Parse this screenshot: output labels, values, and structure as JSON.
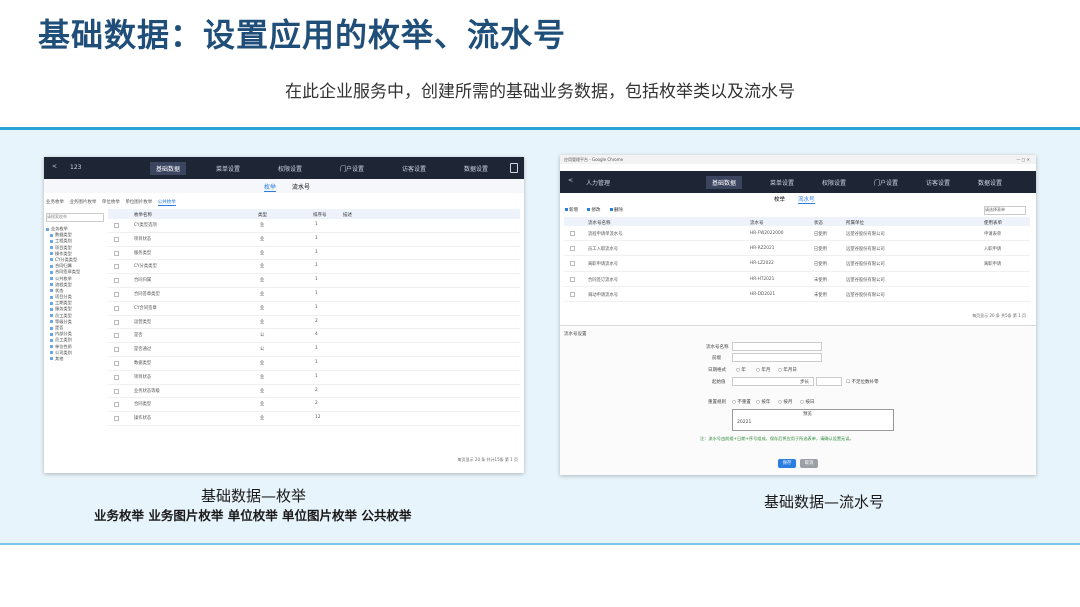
{
  "slide": {
    "title": "基础数据：设置应用的枚举、流水号",
    "subtitle": "在此企业服务中，创建所需的基础业务数据，包括枚举类以及流水号"
  },
  "left_caption": {
    "main": "基础数据—枚举",
    "sub": "业务枚举  业务图片枚举  单位枚举  单位图片枚举  公共枚举"
  },
  "right_caption": {
    "main": "基础数据—流水号"
  },
  "colors": {
    "title": "#1f4e79",
    "band": "#e8f4fb",
    "band_border": "#29a3d6",
    "nav": "#1e2535",
    "accent": "#2a7de1"
  },
  "shot1": {
    "app_name": "123",
    "menus": [
      "基础数据",
      "菜单设置",
      "权限设置",
      "门户设置",
      "访客设置",
      "数据设置"
    ],
    "tabs": [
      "枚举",
      "流水号"
    ],
    "subtabs": [
      "业务枚举",
      "业务图片枚举",
      "单位枚举",
      "单位图片枚举",
      "公共枚举"
    ],
    "search_placeholder": "请搜索枚举",
    "tree": [
      "业务枚举",
      "数据类型",
      "工程类别",
      "项目类型",
      "操作类型",
      "CY分类类型",
      "合同归属",
      "合同签章类型",
      "公共枚举",
      "流程类型",
      "状态",
      "项目分类",
      "工期类型",
      "服务类型",
      "员工类型",
      "等级分类",
      "是否",
      "内部分类",
      "员工类别",
      "单位性质",
      "公司类别",
      "其他"
    ],
    "grid_header": [
      "枚举名称",
      "类型",
      "排序号",
      "描述"
    ],
    "rows": [
      [
        "CY类型选项",
        "业",
        "1"
      ],
      [
        "项目状态",
        "业",
        "1"
      ],
      [
        "服务类型",
        "业",
        "1"
      ],
      [
        "CY分类类型",
        "业",
        "1"
      ],
      [
        "合同归属",
        "业",
        "1"
      ],
      [
        "合同签章类型",
        "业",
        "1"
      ],
      [
        "CY合同签章",
        "业",
        "1"
      ],
      [
        "运营类型",
        "业",
        "2"
      ],
      [
        "是否",
        "公",
        "4"
      ],
      [
        "是否通过",
        "公",
        "1"
      ],
      [
        "数据类型",
        "业",
        "1"
      ],
      [
        "项目状态",
        "业",
        "1"
      ],
      [
        "业务状态等级",
        "业",
        "2"
      ],
      [
        "合同类型",
        "业",
        "2"
      ],
      [
        "操作状态",
        "业",
        "12"
      ]
    ],
    "pager": "每页显示  20  条  共计15条  第 1 页"
  },
  "shot2": {
    "window_title": "应用管理平台 - Google Chrome",
    "app_name": "人力管理",
    "menus": [
      "基础数据",
      "菜单设置",
      "权限设置",
      "门户设置",
      "访客设置",
      "数据设置"
    ],
    "tabs": [
      "枚举",
      "流水号"
    ],
    "toolbar": [
      "新增",
      "修改",
      "删除"
    ],
    "filter": "请选择表单",
    "grid_header": [
      "流水号名称",
      "流水号",
      "状态",
      "所属单位",
      "使用表单"
    ],
    "rows": [
      [
        "流程申请单流水号",
        "HR-FW2022000",
        "已使用",
        "远望谷股份有限公司",
        "申请表单"
      ],
      [
        "员工入职流水号",
        "HR-RZ2021",
        "已使用",
        "远望谷股份有限公司",
        "入职申请"
      ],
      [
        "离职申请流水号",
        "HR-LZ2022",
        "已使用",
        "远望谷股份有限公司",
        "离职申请"
      ],
      [
        "合同签订流水号",
        "HR-HT2021",
        "未使用",
        "远望谷股份有限公司",
        ""
      ],
      [
        "调动申请流水号",
        "HR-DD2021",
        "未使用",
        "远望谷股份有限公司",
        ""
      ]
    ],
    "pager": "每页显示  20  条  共5条  第 1 页",
    "form": {
      "section": "流水号设置",
      "name_label": "流水号名称",
      "prefix_label": "前缀",
      "date_label": "日期格式",
      "date_opts": [
        "年",
        "年月",
        "年月日"
      ],
      "start_label": "起始值",
      "step_label": "步长",
      "zero_label": "不足位数补零",
      "reset_label": "重置规则",
      "reset_opts": [
        "不重置",
        "按年",
        "按月",
        "按日"
      ],
      "preview_label": "预览",
      "preview_value": "20221",
      "note": "注：流水号由前缀+日期+序号组成，保存后将应用于所选表单，请确认设置无误。",
      "save": "保存",
      "cancel": "取消"
    }
  }
}
